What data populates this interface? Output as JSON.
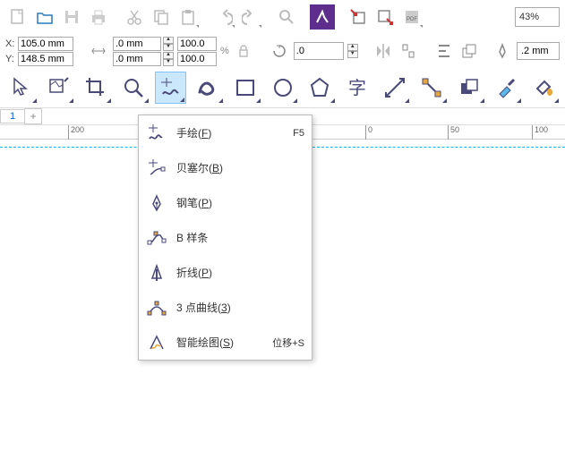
{
  "toolbar": {
    "zoom": "43%"
  },
  "propbar": {
    "x_label": "X:",
    "y_label": "Y:",
    "x_value": "105.0 mm",
    "y_value": "148.5 mm",
    "w_value": ".0 mm",
    "h_value": ".0 mm",
    "scale_x": "100.0",
    "scale_y": "100.0",
    "rotate": ".0",
    "outline": ".2 mm"
  },
  "page_tab": "1",
  "ruler": {
    "ticks": [
      {
        "pos": 76,
        "label": "200"
      },
      {
        "pos": 408,
        "label": "0"
      },
      {
        "pos": 500,
        "label": "50"
      },
      {
        "pos": 594,
        "label": "100"
      }
    ]
  },
  "flyout": {
    "items": [
      {
        "label": "手绘",
        "accel": "F",
        "shortcut": "F5"
      },
      {
        "label": "贝塞尔",
        "accel": "B",
        "shortcut": ""
      },
      {
        "label": "钢笔",
        "accel": "P",
        "shortcut": ""
      },
      {
        "label": "B 样条",
        "accel": "",
        "shortcut": ""
      },
      {
        "label": "折线",
        "accel": "P",
        "shortcut": ""
      },
      {
        "label": "3 点曲线",
        "accel": "3",
        "shortcut": ""
      },
      {
        "label": "智能绘图",
        "accel": "S",
        "shortcut": "位移+S"
      }
    ]
  }
}
